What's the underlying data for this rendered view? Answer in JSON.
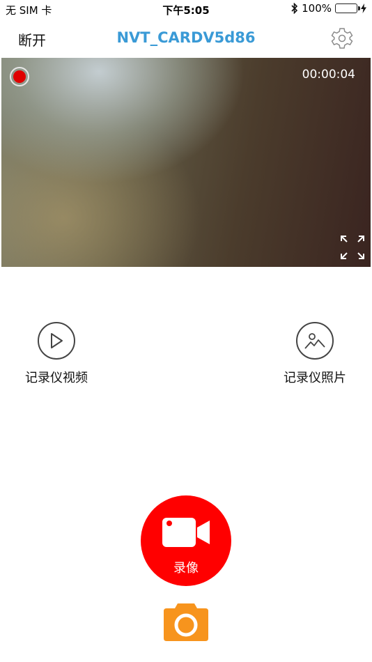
{
  "status_bar": {
    "carrier": "无 SIM 卡",
    "time": "下午5:05",
    "battery_percent": "100%",
    "battery_level": 1.0,
    "battery_color": "#4cd964"
  },
  "nav": {
    "disconnect_label": "断开",
    "title": "NVT_CARDV5d86",
    "title_color": "#3a9ad6"
  },
  "preview": {
    "elapsed": "00:00:04",
    "recording_indicator_color": "#e00000"
  },
  "entries": {
    "videos_label": "记录仪视频",
    "photos_label": "记录仪照片"
  },
  "record_button": {
    "label": "录像",
    "color": "#ff0000"
  },
  "snapshot_button": {
    "color": "#f7941d"
  }
}
